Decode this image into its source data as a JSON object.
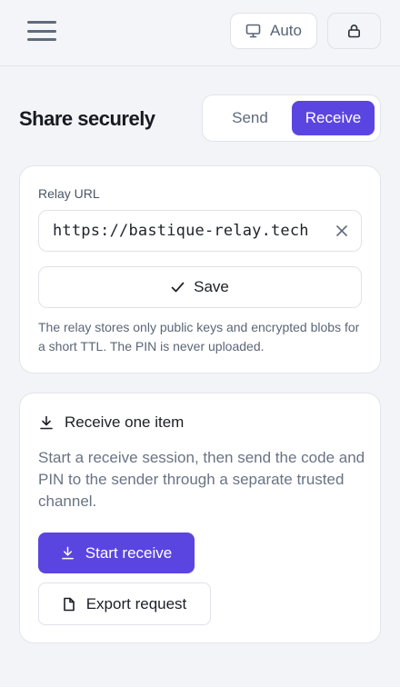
{
  "header": {
    "theme_label": "Auto"
  },
  "page": {
    "title": "Share securely"
  },
  "mode_toggle": {
    "options": [
      {
        "label": "Send",
        "active": false
      },
      {
        "label": "Receive",
        "active": true
      }
    ]
  },
  "relay": {
    "label": "Relay URL",
    "url_value": "https://bastique-relay.tech",
    "save_label": "Save",
    "help_text": "The relay stores only public keys and encrypted blobs for a short TTL. The PIN is never uploaded."
  },
  "receive": {
    "heading": "Receive one item",
    "description": "Start a receive session, then send the code and PIN to the sender through a separate trusted channel.",
    "start_label": "Start receive",
    "export_label": "Export request"
  },
  "colors": {
    "accent": "#5b45e0",
    "page_bg": "#f3f4f7",
    "card_bg": "#ffffff",
    "muted_text": "#6a7384"
  },
  "icons": {
    "menu": "hamburger-icon",
    "theme": "monitor-icon",
    "lock": "lock-icon",
    "clear": "close-icon",
    "save": "check-icon",
    "receive": "download-icon",
    "export": "file-icon"
  }
}
